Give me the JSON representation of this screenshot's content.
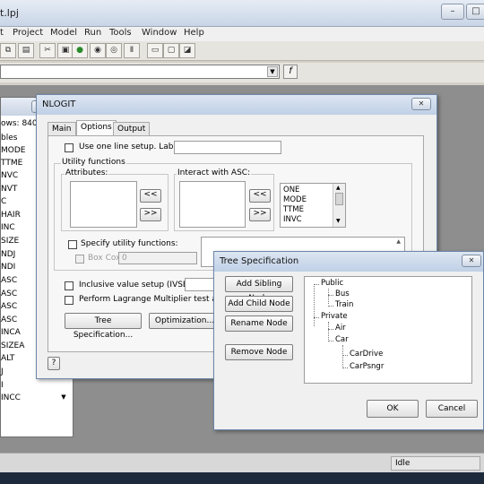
{
  "app": {
    "title": "t.lpj",
    "menu": [
      "t",
      "Project",
      "Model",
      "Run",
      "Tools",
      "Window",
      "Help"
    ],
    "fx_label": "f"
  },
  "var_panel": {
    "rows_label": "ows: 840",
    "items": [
      "bles",
      "MODE",
      "TTME",
      "NVC",
      "NVT",
      "C",
      "HAIR",
      "INC",
      "SIZE",
      "NDJ",
      "NDI",
      "ASC",
      "ASC",
      "ASC",
      "ASC",
      "INCA",
      "SIZEA",
      "ALT",
      "J",
      "I",
      "INCC"
    ]
  },
  "nlogit": {
    "title": "NLOGIT",
    "tabs": [
      "Main",
      "Options",
      "Output"
    ],
    "one_line_label": "Use one line setup. Labels:",
    "utility_group": "Utility functions",
    "attributes_label": "Attributes:",
    "interact_label": "Interact with ASC:",
    "left_add": "<<",
    "right_add": ">>",
    "variables": [
      "ONE",
      "MODE",
      "TTME",
      "INVC"
    ],
    "specify_label": "Specify utility functions:",
    "box_cox_label": "Box Cox",
    "box_cox_value": "0",
    "ivset_label": "Inclusive value setup (IVSET):",
    "lm_test_label": "Perform Lagrange Multiplier test at start",
    "tree_spec_button": "Tree Specification...",
    "optimization_button": "Optimization...",
    "help_button": "?"
  },
  "tree_spec": {
    "title": "Tree Specification",
    "add_sibling": "Add Sibling Node",
    "add_child": "Add Child Node",
    "rename": "Rename Node",
    "remove": "Remove Node",
    "ok": "OK",
    "cancel": "Cancel",
    "nodes": {
      "public": "Public",
      "bus": "Bus",
      "train": "Train",
      "private": "Private",
      "air": "Air",
      "car": "Car",
      "cardrive": "CarDrive",
      "carpsngr": "CarPsngr"
    }
  },
  "status": {
    "text": "Idle"
  }
}
